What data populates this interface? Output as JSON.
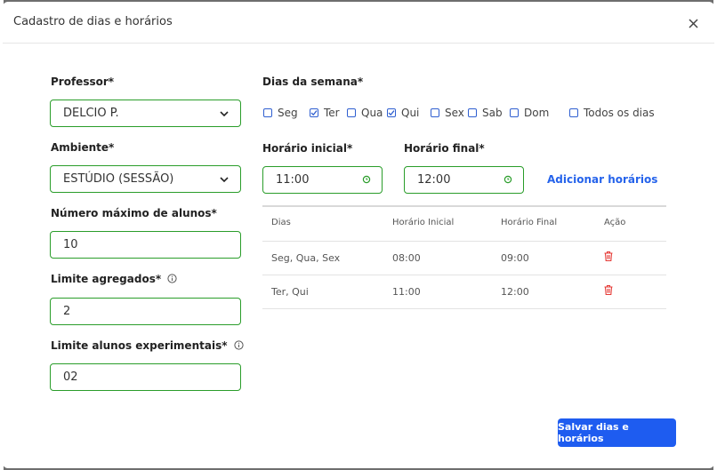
{
  "modal": {
    "title": "Cadastro de dias e horários"
  },
  "form": {
    "professor": {
      "label": "Professor*",
      "value": "DELCIO P."
    },
    "ambiente": {
      "label": "Ambiente*",
      "value": "ESTÚDIO (SESSÃO)"
    },
    "max_alunos": {
      "label": "Número máximo de alunos*",
      "value": "10"
    },
    "limite_agregados": {
      "label": "Limite agregados*",
      "value": "2"
    },
    "limite_experimentais": {
      "label": "Limite alunos experimentais*",
      "value": "02"
    }
  },
  "dias_semana": {
    "label": "Dias da semana*",
    "days": [
      {
        "label": "Seg",
        "checked": false
      },
      {
        "label": "Ter",
        "checked": true
      },
      {
        "label": "Qua",
        "checked": false
      },
      {
        "label": "Qui",
        "checked": true
      },
      {
        "label": "Sex",
        "checked": false
      },
      {
        "label": "Sab",
        "checked": false
      },
      {
        "label": "Dom",
        "checked": false
      },
      {
        "label": "Todos os dias",
        "checked": false
      }
    ]
  },
  "horario": {
    "inicial_label": "Horário inicial*",
    "inicial_value": "11:00",
    "final_label": "Horário final*",
    "final_value": "12:00",
    "add_label": "Adicionar horários"
  },
  "table": {
    "headers": [
      "Dias",
      "Horário Inicial",
      "Horário Final",
      "Ação"
    ],
    "rows": [
      [
        "Seg, Qua, Sex",
        "08:00",
        "09:00"
      ],
      [
        "Ter, Qui",
        "11:00",
        "12:00"
      ]
    ]
  },
  "actions": {
    "save_label": "Salvar dias e horários"
  },
  "colors": {
    "accent": "#2a9d2a",
    "primary_button": "#1e5cf0",
    "link": "#2563eb",
    "delete": "#e53935",
    "checkbox": "#2f5fd0"
  }
}
